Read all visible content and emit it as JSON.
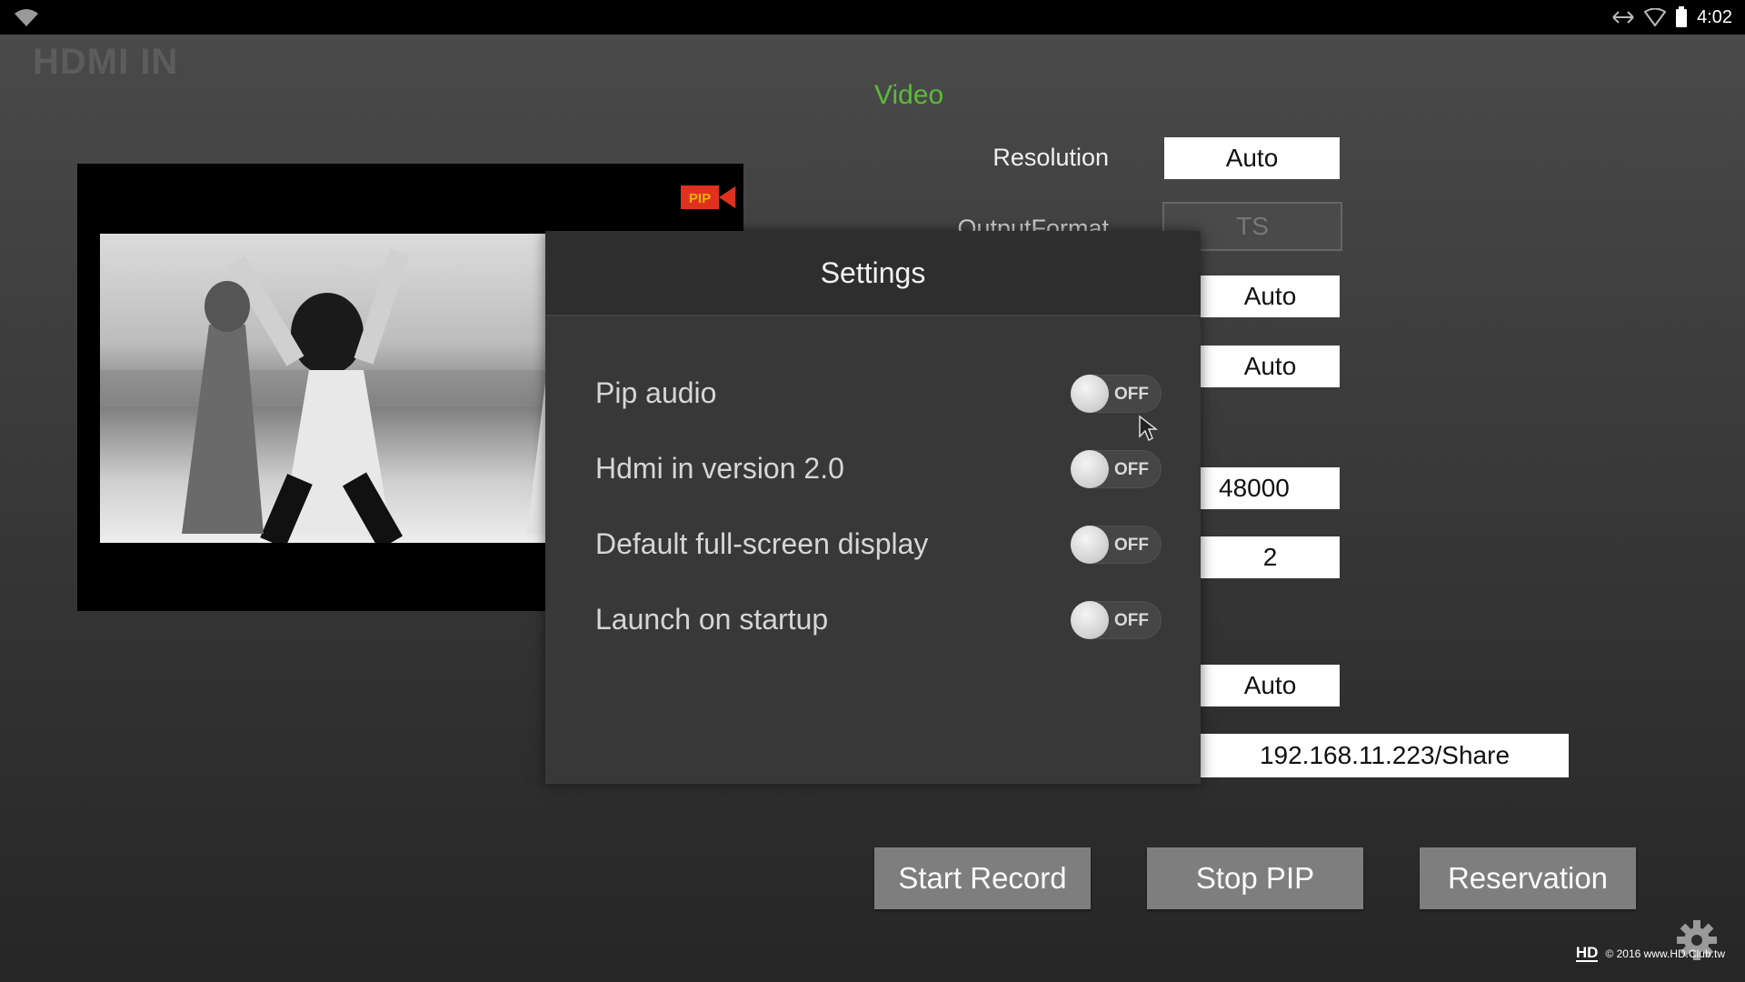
{
  "status_bar": {
    "time": "4:02",
    "icons": [
      "wifi-icon",
      "network-arrows-icon",
      "signal-icon",
      "battery-icon"
    ]
  },
  "app": {
    "title": "HDMI IN"
  },
  "video_section": {
    "title": "Video",
    "rows": [
      {
        "label": "Resolution",
        "value": "Auto"
      },
      {
        "label": "OutputFormat",
        "value": "TS"
      }
    ],
    "fields": [
      "Auto",
      "Auto",
      "48000",
      "2",
      "Auto",
      "192.168.11.223/Share"
    ]
  },
  "pip_badge": "PIP",
  "settings_dialog": {
    "title": "Settings",
    "items": [
      {
        "label": "Pip audio",
        "state": "OFF"
      },
      {
        "label": "Hdmi in version 2.0",
        "state": "OFF"
      },
      {
        "label": "Default full-screen display",
        "state": "OFF"
      },
      {
        "label": "Launch on startup",
        "state": "OFF"
      }
    ]
  },
  "buttons": {
    "start_record": "Start Record",
    "stop_pip": "Stop PIP",
    "reservation": "Reservation"
  },
  "watermark": {
    "logo": "HD",
    "text": "© 2016 www.HD.Club.tw"
  },
  "colors": {
    "accent_green": "#5dbb3c",
    "pip_red": "#e0301e"
  }
}
